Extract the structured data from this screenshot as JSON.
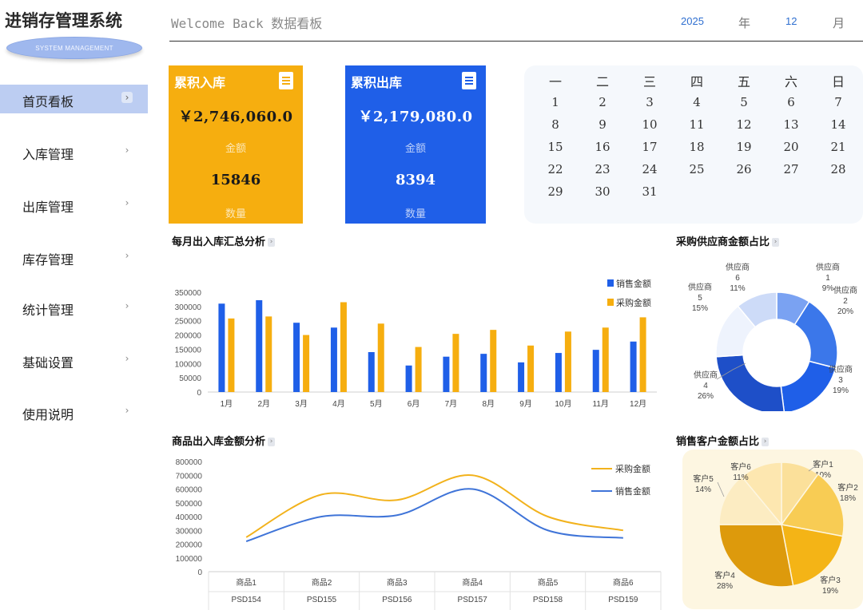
{
  "app": {
    "title": "进销存管理系统",
    "subtitle": "SYSTEM MANAGEMENT"
  },
  "sidebar": {
    "items": [
      {
        "label": "首页看板",
        "chevron": "›",
        "active": true
      },
      {
        "label": "入库管理",
        "chevron": "›"
      },
      {
        "label": "出库管理",
        "chevron": "›"
      },
      {
        "label": "库存管理",
        "chevron": "›"
      },
      {
        "label": "统计管理",
        "chevron": "›"
      },
      {
        "label": "基础设置",
        "chevron": "›"
      },
      {
        "label": "使用说明",
        "chevron": "›"
      }
    ]
  },
  "header": {
    "title": "Welcome Back 数据看板",
    "year": "2025",
    "year_unit": "年",
    "month": "12",
    "month_unit": "月"
  },
  "cards": {
    "inbound": {
      "title": "累积入库",
      "amount": "￥2,746,060.0",
      "amount_label": "金额",
      "qty": "15846",
      "qty_label": "数量",
      "icon": "document-icon"
    },
    "outbound": {
      "title": "累积出库",
      "amount": "￥2,179,080.0",
      "amount_label": "金额",
      "qty": "8394",
      "qty_label": "数量",
      "icon": "document-icon"
    }
  },
  "calendar": {
    "weekdays": [
      "一",
      "二",
      "三",
      "四",
      "五",
      "六",
      "日"
    ],
    "first_weekday_index": 0,
    "days": 31
  },
  "sections": {
    "monthly": "每月出入库汇总分析",
    "supplier": "采购供应商金额占比",
    "product": "商品出入库金额分析",
    "customer": "销售客户金额占比",
    "arrow": "›"
  },
  "colors": {
    "blue": "#1f5fe8",
    "yellow": "#f6ae0f",
    "sidebar_active": "#bccdf2"
  },
  "chart_data": [
    {
      "type": "bar",
      "categories": [
        "1月",
        "2月",
        "3月",
        "4月",
        "5月",
        "6月",
        "7月",
        "8月",
        "9月",
        "10月",
        "11月",
        "12月"
      ],
      "series": [
        {
          "name": "销售金额",
          "color": "#1f5fe8",
          "values": [
            310000,
            322000,
            243000,
            226000,
            140000,
            93000,
            124000,
            134000,
            104000,
            137000,
            148000,
            177000
          ]
        },
        {
          "name": "采购金额",
          "color": "#f6ae0f",
          "values": [
            258000,
            265000,
            200000,
            315000,
            240000,
            158000,
            204000,
            218000,
            163000,
            212000,
            226000,
            262000
          ]
        }
      ],
      "yticks": [
        "0",
        "50000",
        "100000",
        "150000",
        "200000",
        "250000",
        "300000",
        "350000"
      ],
      "ylim": [
        0,
        350000
      ],
      "legend": "top-right"
    },
    {
      "type": "pie",
      "style": "donut",
      "slices": [
        {
          "name": "供应商1",
          "value": 9,
          "label": "供应商\n1\n9%",
          "color": "#7aa2f2"
        },
        {
          "name": "供应商2",
          "value": 20,
          "label": "供应商\n2\n20%",
          "color": "#3b77ea"
        },
        {
          "name": "供应商3",
          "value": 19,
          "label": "供应商\n3\n19%",
          "color": "#1f5fe8"
        },
        {
          "name": "供应商4",
          "value": 26,
          "label": "供应商\n4\n26%",
          "color": "#1e4fc8"
        },
        {
          "name": "供应商5",
          "value": 15,
          "label": "供应商\n5\n15%",
          "color": "#eef3fd"
        },
        {
          "name": "供应商6",
          "value": 11,
          "label": "供应商\n6\n11%",
          "color": "#cddbf8"
        }
      ]
    },
    {
      "type": "line",
      "categories": [
        "商品1",
        "商品2",
        "商品3",
        "商品4",
        "商品5",
        "商品6"
      ],
      "category_codes": [
        "PSD154",
        "PSD155",
        "PSD156",
        "PSD157",
        "PSD158",
        "PSD159"
      ],
      "series": [
        {
          "name": "采购金额",
          "color": "#f2b21c",
          "values": [
            250000,
            560000,
            520000,
            700000,
            400000,
            300000
          ]
        },
        {
          "name": "销售金额",
          "color": "#3f74d8",
          "values": [
            220000,
            400000,
            410000,
            600000,
            300000,
            245000
          ]
        }
      ],
      "yticks": [
        "0",
        "100000",
        "200000",
        "300000",
        "400000",
        "500000",
        "600000",
        "700000",
        "800000"
      ],
      "ylim": [
        0,
        800000
      ],
      "legend": "top-right"
    },
    {
      "type": "pie",
      "slices": [
        {
          "name": "客户1",
          "value": 10,
          "label": "客户1\n10%",
          "color": "#fbe09a"
        },
        {
          "name": "客户2",
          "value": 18,
          "label": "客户2\n18%",
          "color": "#f8cc54"
        },
        {
          "name": "客户3",
          "value": 19,
          "label": "客户3\n19%",
          "color": "#f4b416"
        },
        {
          "name": "客户4",
          "value": 28,
          "label": "客户4\n28%",
          "color": "#dd9a0c"
        },
        {
          "name": "客户5",
          "value": 14,
          "label": "客户5\n14%",
          "color": "#fcecc2"
        },
        {
          "name": "客户6",
          "value": 11,
          "label": "客户6\n11%",
          "color": "#fde7b0"
        }
      ]
    }
  ]
}
